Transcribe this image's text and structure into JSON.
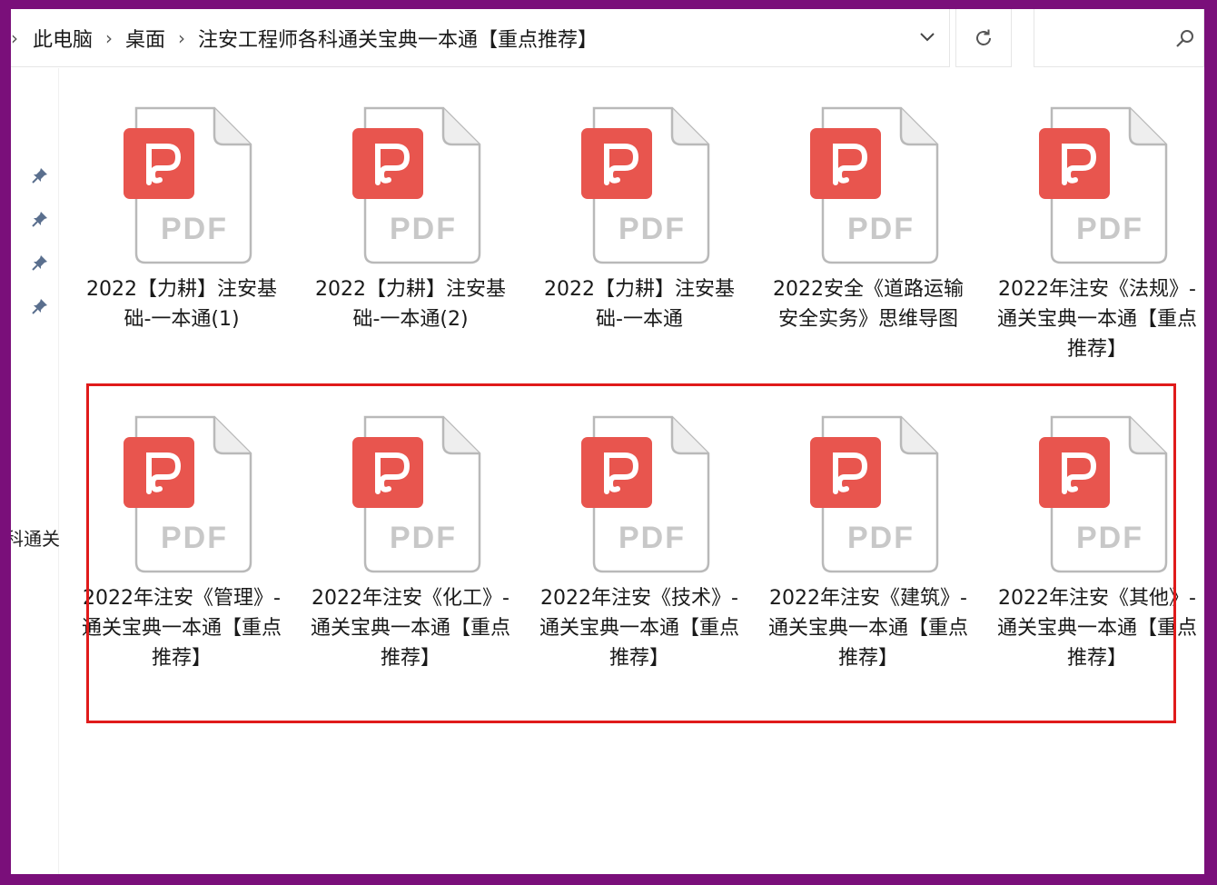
{
  "addressbar": {
    "crumbs": [
      "此电脑",
      "桌面",
      "注安工程师各科通关宝典一本通【重点推荐】"
    ],
    "search_placeholder": ""
  },
  "nav": {
    "partial_text": "科通关"
  },
  "files": [
    {
      "name": "2022【力耕】注安基础-一本通(1)",
      "type": "pdf",
      "icon_text": "PDF"
    },
    {
      "name": "2022【力耕】注安基础-一本通(2)",
      "type": "pdf",
      "icon_text": "PDF"
    },
    {
      "name": "2022【力耕】注安基础-一本通",
      "type": "pdf",
      "icon_text": "PDF"
    },
    {
      "name": "2022安全《道路运输安全实务》思维导图",
      "type": "pdf",
      "icon_text": "PDF"
    },
    {
      "name": "2022年注安《法规》-通关宝典一本通【重点推荐】",
      "type": "pdf",
      "icon_text": "PDF"
    },
    {
      "name": "2022年注安《管理》-通关宝典一本通【重点推荐】",
      "type": "pdf",
      "icon_text": "PDF"
    },
    {
      "name": "2022年注安《化工》-通关宝典一本通【重点推荐】",
      "type": "pdf",
      "icon_text": "PDF"
    },
    {
      "name": "2022年注安《技术》-通关宝典一本通【重点推荐】",
      "type": "pdf",
      "icon_text": "PDF"
    },
    {
      "name": "2022年注安《建筑》-通关宝典一本通【重点推荐】",
      "type": "pdf",
      "icon_text": "PDF"
    },
    {
      "name": "2022年注安《其他》-通关宝典一本通【重点推荐】",
      "type": "pdf",
      "icon_text": "PDF"
    }
  ],
  "icons": {
    "pin": "pin-icon",
    "refresh": "refresh-icon",
    "search": "search-icon",
    "dropdown": "chevron-down-icon",
    "pdf": "pdf-file-icon"
  },
  "colors": {
    "frame": "#7a0f7a",
    "pdf_badge": "#e8554e",
    "highlight": "#e01b1b"
  }
}
